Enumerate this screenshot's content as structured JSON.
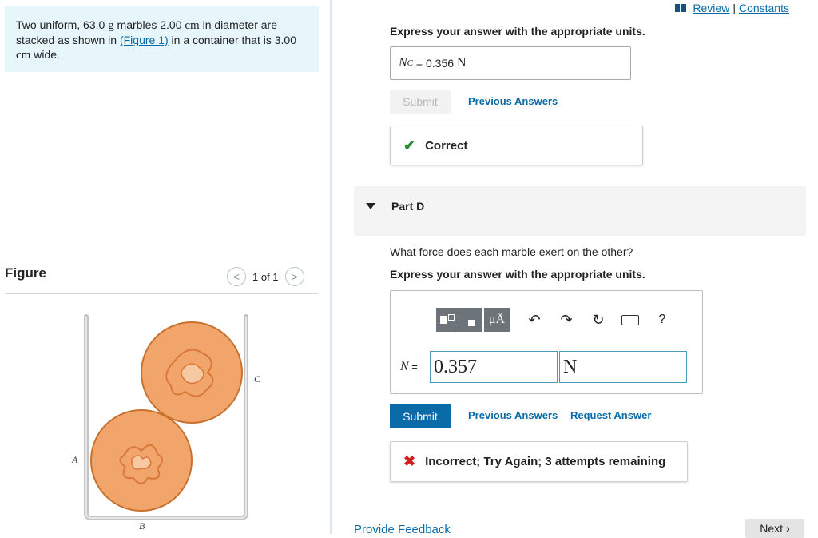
{
  "problem": {
    "text_1": "Two uniform, 63.0 ",
    "unit_g": "g",
    "text_2": " marbles 2.00 ",
    "unit_cm_1": "cm",
    "text_3": " in diameter are stacked as shown in ",
    "figure_link": "(Figure 1)",
    "text_4": " in a container that is 3.00 ",
    "unit_cm_2": "cm",
    "text_5": " wide."
  },
  "figure": {
    "title": "Figure",
    "pager": "1 of 1",
    "prev_symbol": "<",
    "next_symbol": ">",
    "labels": {
      "a": "A",
      "b": "B",
      "c": "C"
    },
    "marble_color": "#f2a56b"
  },
  "header": {
    "review": "Review",
    "sep": "|",
    "constants": "Constants"
  },
  "part_c": {
    "express": "Express your answer with the appropriate units.",
    "answer_var": "N",
    "answer_sub": "C",
    "answer_eq": " = ",
    "answer_value": "0.356",
    "answer_unit": "N",
    "submit": "Submit",
    "previous_answers": "Previous Answers",
    "feedback": "Correct"
  },
  "part_d": {
    "label": "Part D",
    "question": "What force does each marble exert on the other?",
    "express": "Express your answer with the appropriate units.",
    "toolbar": {
      "units_label": "μÅ",
      "help": "?"
    },
    "eq_var": "N",
    "eq_sign": " = ",
    "value": "0.357",
    "unit": "N",
    "submit": "Submit",
    "previous_answers": "Previous Answers",
    "request_answer": "Request Answer",
    "feedback": "Incorrect; Try Again; 3 attempts remaining"
  },
  "footer": {
    "provide_feedback": "Provide Feedback",
    "next": "Next"
  },
  "colors": {
    "accent": "#0b6ba8",
    "correct": "#2e8b2e",
    "incorrect": "#d0201f",
    "panel": "#e6f6fa"
  }
}
